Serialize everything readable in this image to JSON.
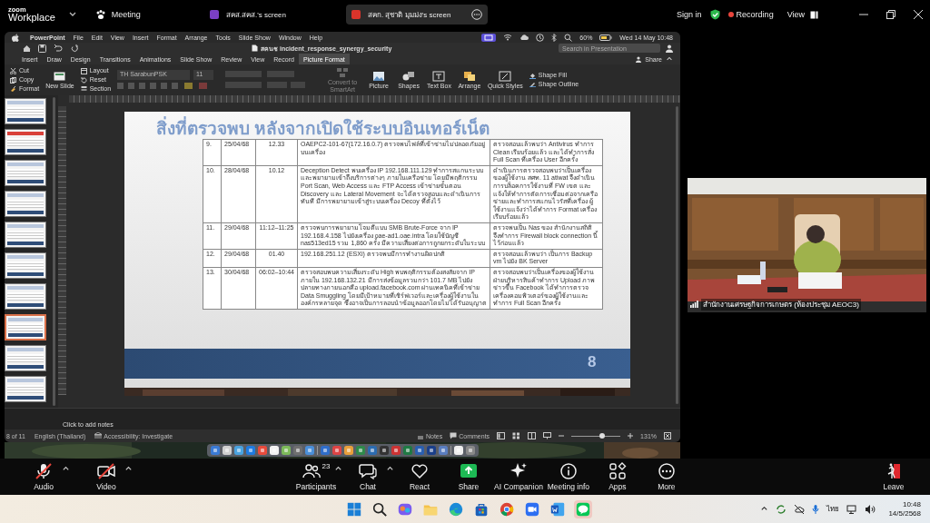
{
  "zoom_header": {
    "brand": "zoom",
    "product": "Workplace",
    "meeting_label": "Meeting",
    "screens": [
      {
        "label": "สคส.สคส.'s screen",
        "color": "#7b3fc4",
        "selected": false
      },
      {
        "label": "สคก. สุชาติ มุมม่ง's screen",
        "color": "#d9342b",
        "selected": true
      }
    ],
    "sign_in": "Sign in",
    "recording": "Recording",
    "view": "View"
  },
  "mac_menubar": {
    "app": "PowerPoint",
    "menus": [
      "File",
      "Edit",
      "View",
      "Insert",
      "Format",
      "Arrange",
      "Tools",
      "Slide Show",
      "Window",
      "Help"
    ],
    "battery": "60%",
    "clock": "Wed 14 May  10:48"
  },
  "powerpoint": {
    "document_title": "สคนช incident_response_synergy_security",
    "search_placeholder": "Search in Presentation",
    "tabs": [
      {
        "label": "Insert",
        "selected": false
      },
      {
        "label": "Draw",
        "selected": false
      },
      {
        "label": "Design",
        "selected": false
      },
      {
        "label": "Transitions",
        "selected": false
      },
      {
        "label": "Animations",
        "selected": false
      },
      {
        "label": "Slide Show",
        "selected": false
      },
      {
        "label": "Review",
        "selected": false
      },
      {
        "label": "View",
        "selected": false
      },
      {
        "label": "Record",
        "selected": false
      },
      {
        "label": "Picture Format",
        "selected": true
      }
    ],
    "share": "Share",
    "ribbon": {
      "clipboard": [
        "Cut",
        "Copy",
        "Format"
      ],
      "new_slide": "New Slide",
      "slide_commands": [
        "Layout",
        "Reset",
        "Section"
      ],
      "font": "TH SarabunPSK",
      "font_size": "11",
      "convert": "Convert to SmartArt",
      "insert": [
        "Picture",
        "Shapes",
        "Text Box"
      ],
      "arrange": [
        "Arrange",
        "Quick Styles"
      ],
      "shape_format": [
        "Shape Fill",
        "Shape Outline"
      ]
    },
    "thumbnails": [
      {
        "selected": false
      },
      {
        "selected": false
      },
      {
        "selected": false
      },
      {
        "selected": false
      },
      {
        "selected": false
      },
      {
        "selected": false
      },
      {
        "selected": false
      },
      {
        "selected": true
      },
      {
        "selected": false
      },
      {
        "selected": false
      }
    ],
    "slide": {
      "title": "สิ่งที่ตรวจพบ หลังจากเปิดใช้ระบบอินเทอร์เน็ต",
      "page_number": "8",
      "table_rows": [
        [
          "9.",
          "25/04/68",
          "12.33",
          "OAEPC2-101-67(172.16.0.7) ตรวจพบไฟล์ที่เข้าข่ายไม่ปลอดภัยอยู่บนเครื่อง",
          "ตรวจสอบแล้วพบว่า Antivirus ทำการ Clean เรียบร้อยแล้ว และได้ทำการสั่ง Full Scan ที่เครื่อง User อีกครั้ง"
        ],
        [
          "10.",
          "28/04/68",
          "10.12",
          "Deception Detect พบเครื่อง IP 192.168.111.129 ทำการสแกนระบบและพยายามเข้าถึงบริการต่างๆ ภายในเครือข่าย โดยมีพฤติกรรม Port Scan, Web Access และ FTP Access เข้าข่ายขั้นตอน Discovery และ Lateral Movement จะได้ตรวจสอบและดำเนินการทันที มีการพยายามเข้าสู่ระบบเครื่อง Decoy ที่ตั้งไว้",
          "ดำเนินการตรวจสอบพบว่าเป็นเครื่องของผู้ใช้งาน สศท. 11 atiwat จึงดำเนินการบล็อคการใช้งานที่ FW เขต และแจ้งให้ทำการตัดการเชื่อมต่อจากเครือข่ายและทำการสแกนไวรัสที่เครื่อง ผู้ใช้งานแจ้งว่าได้ทำการ Format เครื่องเรียบร้อยแล้ว"
        ],
        [
          "11.",
          "29/04/68",
          "11:12–11:25",
          "ตรวจพบการพยายามโจมตีแบบ SMB Brute-Force จาก IP 192.168.4.158 ไปยังเครื่อง oae-ad1.oae.intra โดยใช้บัญชี nas513ed15 รวม 1,860 ครั้ง มีความเสี่ยงต่อการถูกยกระดับในระบบ",
          "ตรวจพบเป็น Nas ของ สำนักงานสถิติ จึงทำการ Firewall block connection นี้ไว้ก่อนแล้ว"
        ],
        [
          "12.",
          "29/04/68",
          "01.40",
          "192.168.251.12 (ESXi) ตรวจพบมีการทำงานผิดปกติ",
          "ตรวจสอบแล้วพบว่า เป็นการ Backup vm ไปยัง BK Server"
        ],
        [
          "13.",
          "30/04/68",
          "06:02–10:44",
          "ตรวจสอบพบความเสี่ยงระดับ High พบพฤติกรรมต้องสงสัยจาก IP ภายใน 192.168.132.21 มีการส่งข้อมูลรวมกว่า 101.7 MB ไปยังปลายทางภายนอกคือ upload.facebook.com ผ่านเทคนิคที่เข้าข่าย Data Smuggling โดยมีเป้าหมายที่เซิร์ฟเวอร์และเครื่องผู้ใช้งานในองค์กรหลายจุด ซึ่งอาจเป็นการลอบนำข้อมูลออกโดยไม่ได้รับอนุญาต",
          "ตรวจสอบพบว่าเป็นเครื่องของผู้ใช้งานฝ่ายบริหารสินค้าทำการ Upload ภาพข่าวขึ้น Facebook ได้ทำการตรวจเครื่องคอมพิวเตอร์ของผู้ใช้งานและทำการ Full Scan อีกครั้ง"
        ]
      ]
    },
    "notes_placeholder": "Click to add notes",
    "status": {
      "slide_count": "8 of 11",
      "language": "English (Thailand)",
      "accessibility": "Accessibility: Investigate",
      "notes": "Notes",
      "comments": "Comments",
      "zoom": "131%",
      "zoom_level": {
        "level": 0.62
      }
    }
  },
  "video_tile": {
    "name": "สำนักงานเศรษฐกิจการเกษตร (ห้องประชุม AEOC3)"
  },
  "toolbar": {
    "left_buttons": [
      {
        "kind": "audio",
        "label": "Audio",
        "muted": true,
        "menu": true
      },
      {
        "kind": "video",
        "label": "Video",
        "muted": true,
        "menu": true
      }
    ],
    "center_buttons": [
      {
        "kind": "participants",
        "label": "Participants",
        "count": "23",
        "muted": false,
        "menu": true
      },
      {
        "kind": "chat",
        "label": "Chat",
        "muted": false,
        "menu": true
      },
      {
        "kind": "react",
        "label": "React",
        "muted": false,
        "menu": false
      },
      {
        "kind": "share",
        "label": "Share",
        "muted": false,
        "menu": false
      },
      {
        "kind": "ai",
        "label": "AI Companion",
        "muted": false,
        "menu": false
      },
      {
        "kind": "info",
        "label": "Meeting info",
        "muted": false,
        "menu": false
      },
      {
        "kind": "apps",
        "label": "Apps",
        "muted": false,
        "menu": false
      },
      {
        "kind": "more",
        "label": "More",
        "muted": false,
        "menu": false
      }
    ],
    "leave": "Leave"
  },
  "taskbar": {
    "apps": [
      {
        "selected": false
      },
      {
        "selected": false
      },
      {
        "selected": false
      },
      {
        "selected": false
      },
      {
        "selected": false
      },
      {
        "selected": false
      },
      {
        "selected": false
      },
      {
        "selected": false
      },
      {
        "selected": false
      },
      {
        "selected": true
      }
    ],
    "input_language": "ไทย",
    "time": "10:48",
    "date": "14/5/2568"
  }
}
